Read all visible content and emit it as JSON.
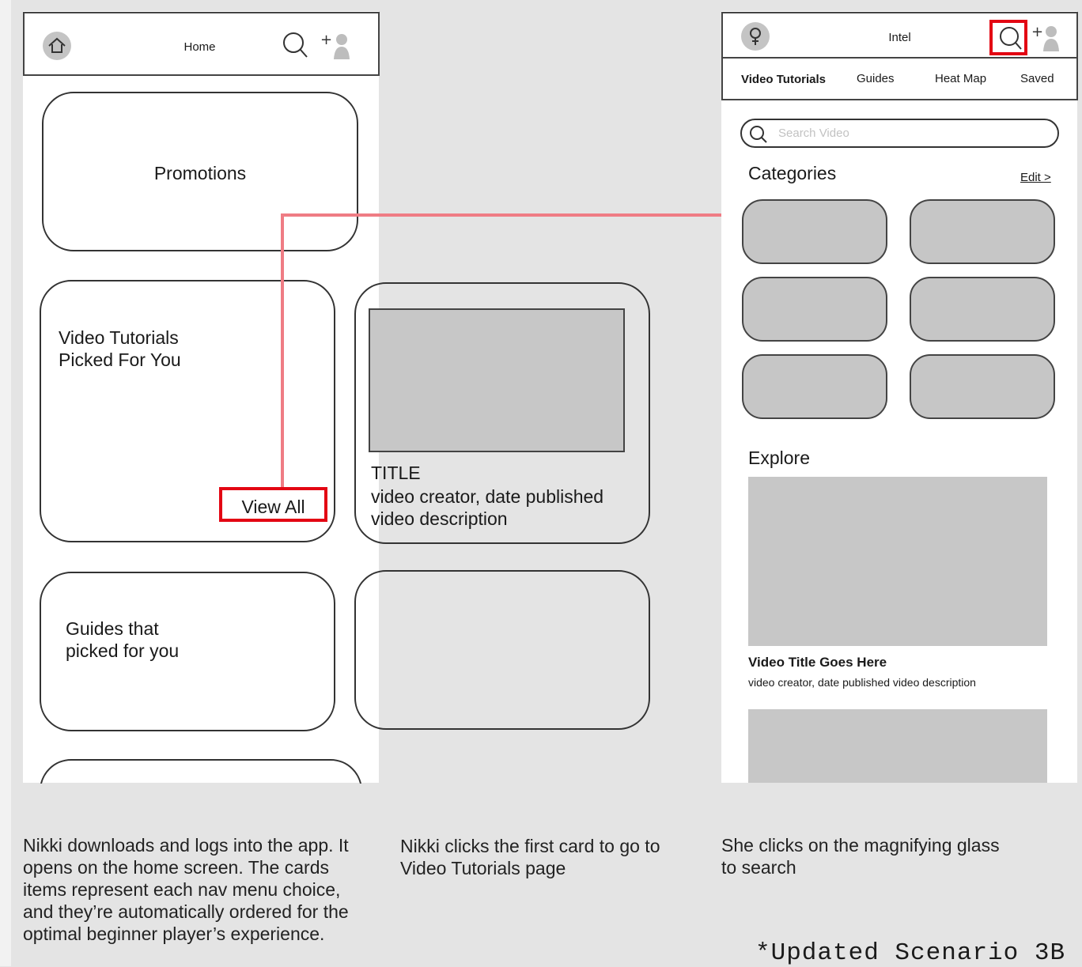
{
  "screen1": {
    "title": "Home",
    "promotions": "Promotions",
    "video_card": "Video Tutorials\nPicked For You",
    "view_all": "View All",
    "guides_card": "Guides that\npicked for you",
    "video_item": {
      "title": "TITLE",
      "meta": "video creator, date published",
      "desc": "video description"
    }
  },
  "screen2": {
    "title": "Intel",
    "tabs": [
      "Video Tutorials",
      "Guides",
      "Heat Map",
      "Saved"
    ],
    "search_placeholder": "Search Video",
    "categories_heading": "Categories",
    "edit_link": "Edit >",
    "explore_heading": "Explore",
    "video_title": "Video Title Goes Here",
    "video_meta": "video creator, date published video description"
  },
  "captions": [
    "Nikki downloads and logs into the app. It\nopens on the home screen. The cards\nitems represent each nav menu choice,\nand they’re automatically ordered for the\noptimal beginner player’s experience.",
    "Nikki clicks the first card to go to\nVideo Tutorials page",
    "She clicks on the magnifying glass\nto search"
  ],
  "footnote": "*Updated Scenario 3B",
  "colors": {
    "highlight": "#e30613",
    "connector": "#ef7c84",
    "placeholder": "#c7c7c7",
    "background": "#e4e4e4"
  }
}
